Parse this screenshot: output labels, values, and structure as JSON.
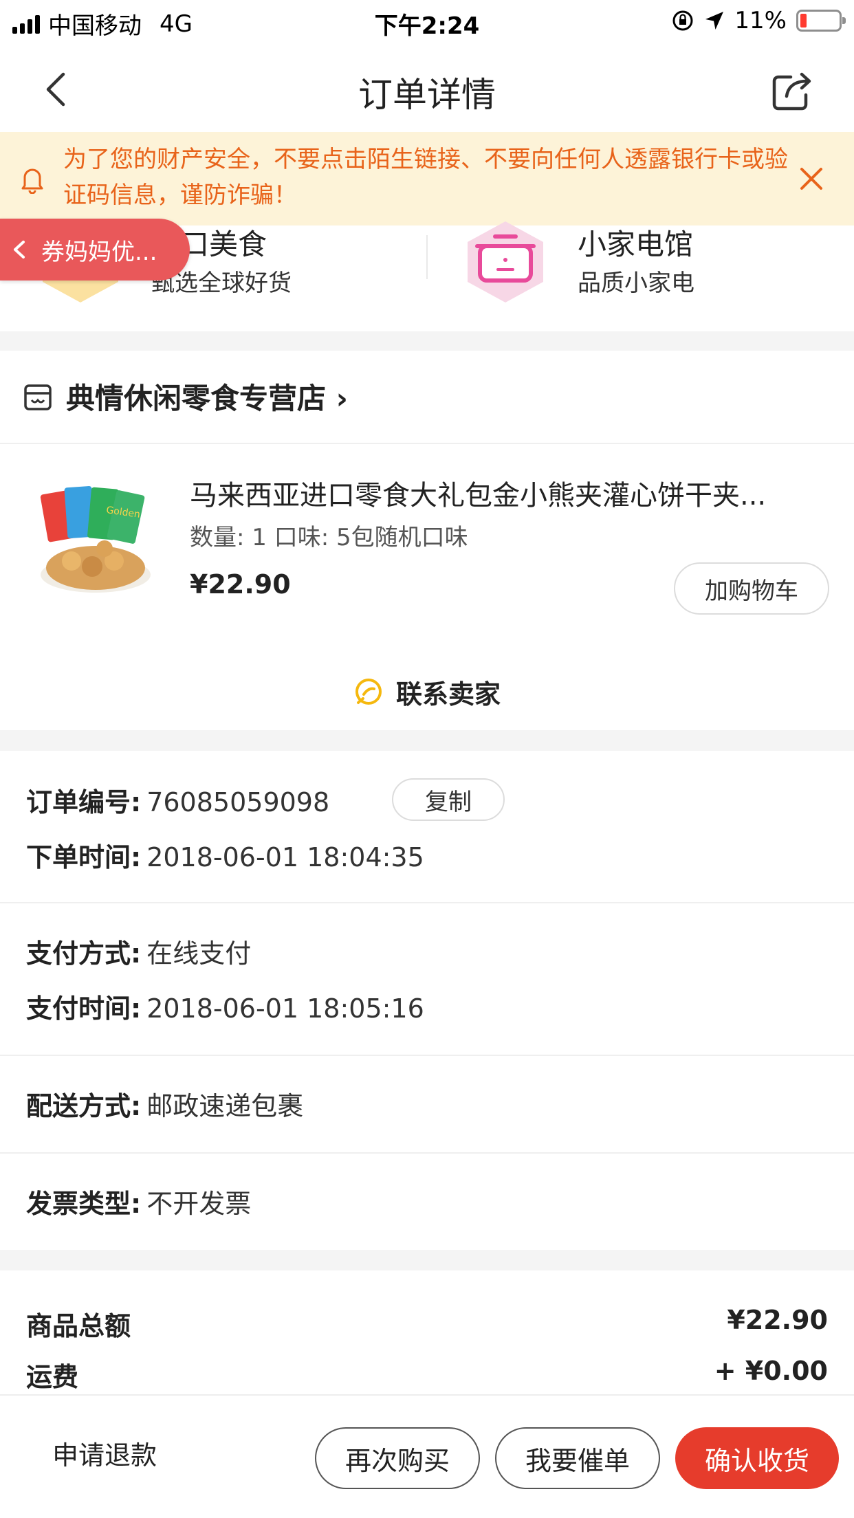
{
  "status_bar": {
    "carrier": "中国移动",
    "network": "4G",
    "time": "下午2:24",
    "battery": "11%",
    "battery_level": 0.11
  },
  "nav": {
    "title": "订单详情",
    "back_icon": "chevron-left-icon",
    "share_icon": "share-icon"
  },
  "warning": {
    "text": "为了您的财产安全，不要点击陌生链接、不要向任何人透露银行卡或验证码信息，谨防诈骗！",
    "icon": "bell-icon",
    "close_icon": "close-icon"
  },
  "categories": [
    {
      "name": "进口美食",
      "sub": "甄选全球好货"
    },
    {
      "name": "小家电馆",
      "sub": "品质小家电"
    }
  ],
  "coupon_tab": {
    "label": "券妈妈优..."
  },
  "store": {
    "name": "典情休闲零食专营店",
    "arrow": "›",
    "product": {
      "title": "马来西亚进口零食大礼包金小熊夹灌心饼干夹...",
      "spec": "数量: 1 口味: 5包随机口味",
      "price": "¥22.90",
      "add_cart": "加购物车"
    },
    "contact": "联系卖家"
  },
  "order_info": {
    "order_no_label": "订单编号:",
    "order_no": "76085059098",
    "copy": "复制",
    "order_time_label": "下单时间:",
    "order_time": "2018-06-01 18:04:35",
    "pay_method_label": "支付方式:",
    "pay_method": "在线支付",
    "pay_time_label": "支付时间:",
    "pay_time": "2018-06-01 18:05:16",
    "delivery_label": "配送方式:",
    "delivery": "邮政速递包裹",
    "invoice_label": "发票类型:",
    "invoice": "不开发票"
  },
  "totals": {
    "goods_label": "商品总额",
    "goods_value": "¥22.90",
    "shipping_label": "运费",
    "shipping_value": "+ ¥0.00"
  },
  "bottom_bar": {
    "refund": "申请退款",
    "rebuy": "再次购买",
    "urge": "我要催单",
    "confirm": "确认收货"
  },
  "colors": {
    "accent": "#e63c2c",
    "warning_text": "#e8631a",
    "warning_bg": "#fdf3d8",
    "coupon_bg": "#e9585a"
  }
}
